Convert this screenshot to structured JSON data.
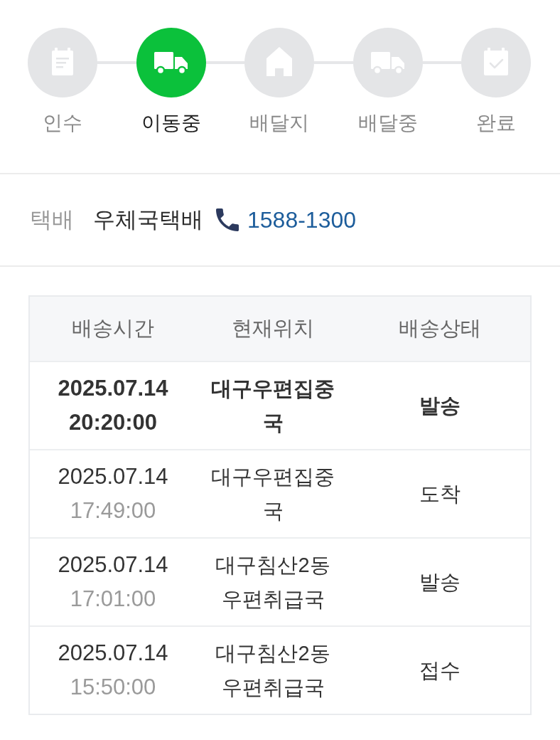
{
  "steps": [
    {
      "label": "인수",
      "selected": false
    },
    {
      "label": "이동중",
      "selected": true
    },
    {
      "label": "배달지",
      "selected": false
    },
    {
      "label": "배달중",
      "selected": false
    },
    {
      "label": "완료",
      "selected": false
    }
  ],
  "courier": {
    "label": "택배",
    "name": "우체국택배",
    "phone": "1588-1300"
  },
  "tracking_table": {
    "columns": [
      "배송시간",
      "현재위치",
      "배송상태"
    ],
    "rows": [
      {
        "date": "2025.07.14",
        "time": "20:20:00",
        "location": "대구우편집중국",
        "status": "발송",
        "latest": true
      },
      {
        "date": "2025.07.14",
        "time": "17:49:00",
        "location": "대구우편집중국",
        "status": "도착",
        "latest": false
      },
      {
        "date": "2025.07.14",
        "time": "17:01:00",
        "location": "대구침산2동 우편취급국",
        "status": "발송",
        "latest": false
      },
      {
        "date": "2025.07.14",
        "time": "15:50:00",
        "location": "대구침산2동 우편취급국",
        "status": "접수",
        "latest": false
      }
    ]
  }
}
